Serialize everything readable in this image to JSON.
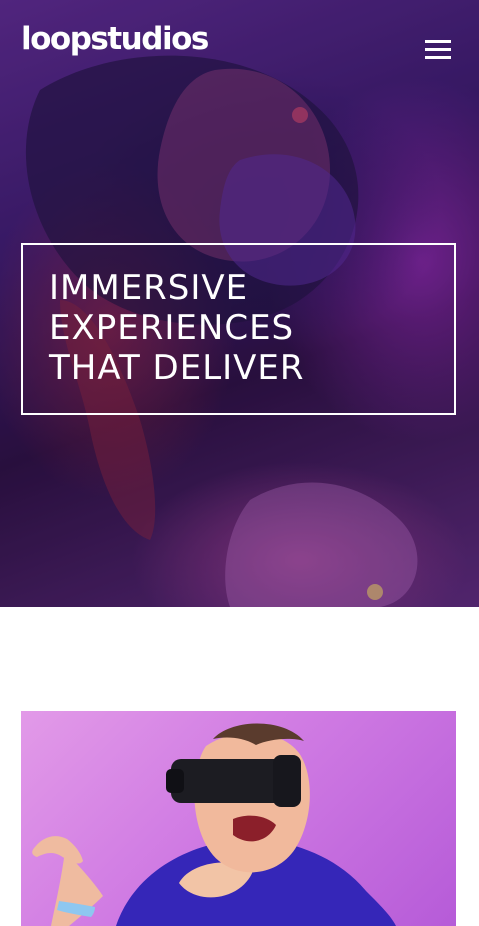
{
  "header": {
    "logo": "loopstudios",
    "menu_icon": "hamburger-menu-icon"
  },
  "hero": {
    "title": "IMMERSIVE\nEXPERIENCES\nTHAT DELIVER"
  },
  "feature": {
    "image_name": "vr-headset-man-image"
  },
  "colors": {
    "hero_overlay": "#3a1a6a",
    "accent_pink": "#d07be3",
    "text_white": "#ffffff",
    "shirt_blue": "#3526b8"
  }
}
